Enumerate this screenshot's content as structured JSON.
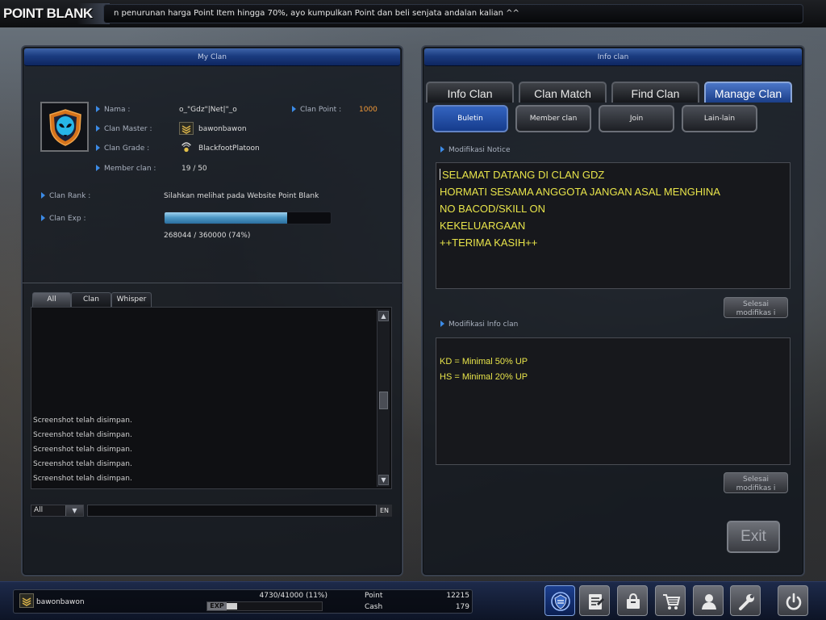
{
  "topbar": {
    "logo": "POINT BLANK",
    "ticker": "n penurunan harga Point Item hingga 70%, ayo kumpulkan Point dan beli senjata andalan kalian ^^"
  },
  "my_clan": {
    "title": "My Clan",
    "fields": {
      "name_label": "Nama :",
      "name_value": "o_\"Gdz\"|Net|\"_o",
      "clan_point_label": "Clan Point :",
      "clan_point_value": "1000",
      "master_label": "Clan Master :",
      "master_value": "bawonbawon",
      "grade_label": "Clan Grade :",
      "grade_value": "BlackfootPlatoon",
      "member_label": "Member clan :",
      "member_value": "19 / 50",
      "rank_label": "Clan Rank :",
      "rank_value": "Silahkan melihat pada Website Point Blank",
      "exp_label": "Clan Exp :",
      "exp_value": "268044 / 360000 (74%)",
      "exp_fraction": 0.74
    },
    "chat": {
      "tabs": [
        "All",
        "Clan",
        "Whisper"
      ],
      "lines": [
        "Screenshot telah disimpan.",
        "Screenshot telah disimpan.",
        "Screenshot telah disimpan.",
        "Screenshot telah disimpan.",
        "Screenshot telah disimpan."
      ],
      "channel": "All",
      "input_value": "",
      "lang": "EN"
    }
  },
  "info_clan": {
    "title": "Info clan",
    "tabs": [
      "Info Clan",
      "Clan Match",
      "Find Clan",
      "Manage Clan"
    ],
    "subtabs": [
      "Buletin",
      "Member clan",
      "Join",
      "Lain-lain"
    ],
    "notice_label": "Modifikasi Notice",
    "notice_lines": [
      "SELAMAT DATANG DI CLAN GDZ",
      "HORMATI SESAMA ANGGOTA JANGAN ASAL MENGHINA",
      "NO BACOD/SKILL ON",
      "KEKELUARGAAN",
      "++TERIMA KASIH++"
    ],
    "save_label": "Selesai modifikas i",
    "info_label": "Modifikasi Info clan",
    "info_lines": [
      "KD = Minimal 50% UP",
      "HS = Minimal 20% UP"
    ],
    "exit_label": "Exit"
  },
  "statusbar": {
    "nickname": "bawonbawon",
    "exp_text": "4730/41000 (11%)",
    "exp_tag": "EXP",
    "exp_fraction": 0.11,
    "point_label": "Point",
    "point_value": "12215",
    "cash_label": "Cash",
    "cash_value": "179"
  },
  "colors": {
    "accent_blue": "#1b3e88",
    "notice_text": "#e8e44a",
    "clan_point": "#f29a38",
    "exp_bar": "#4f99c6"
  },
  "icons": [
    "alien-emblem-icon",
    "rank-chevron-icon",
    "grade-badge-icon",
    "clan-icon",
    "inventory-icon",
    "shop-bag-icon",
    "cart-icon",
    "friends-icon",
    "settings-wrench-icon",
    "power-icon"
  ]
}
